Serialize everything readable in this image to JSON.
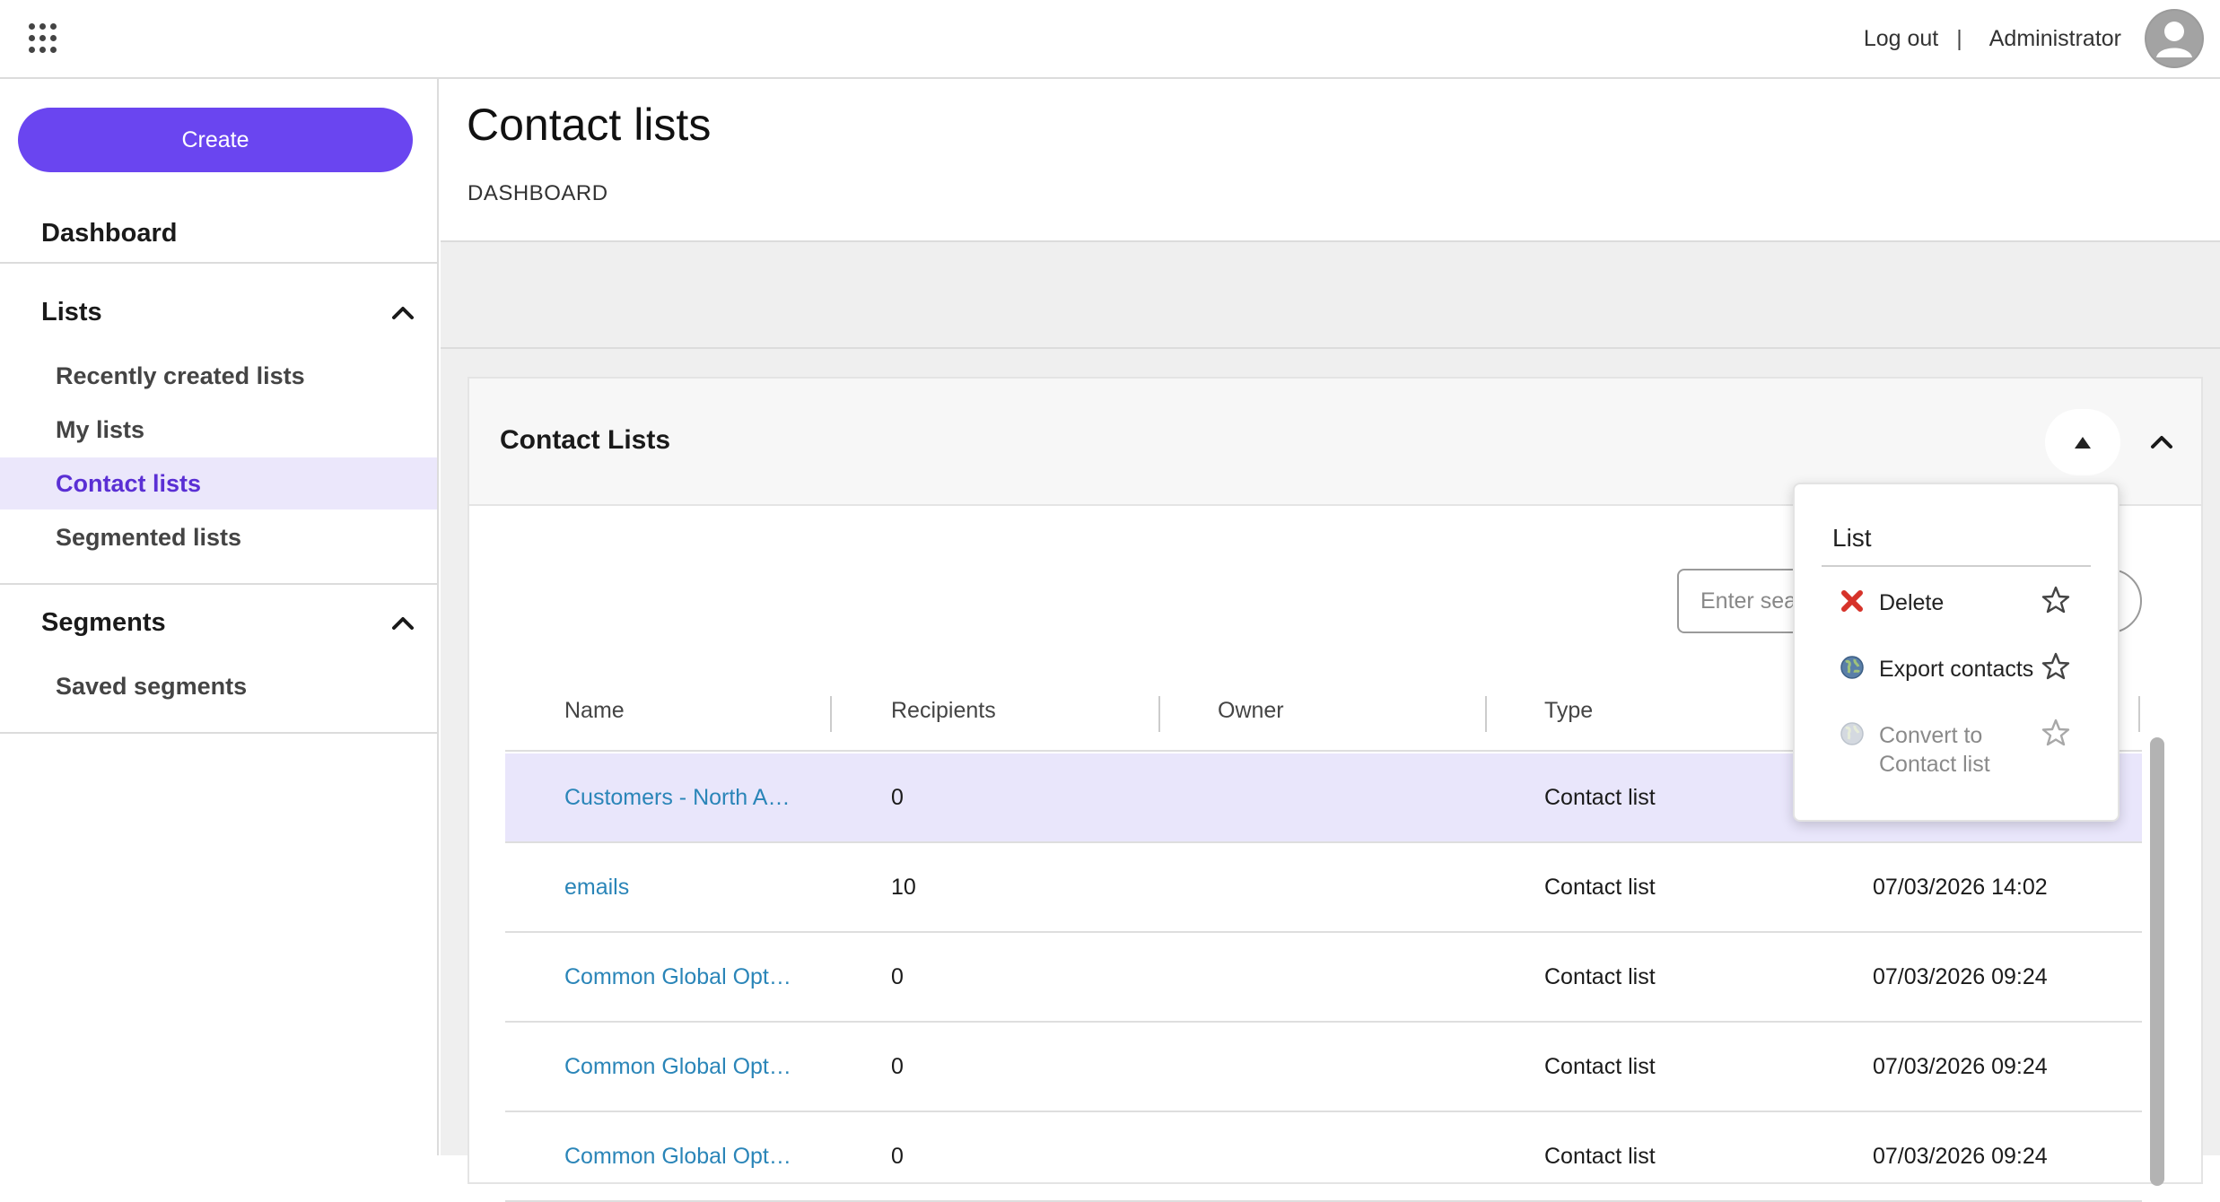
{
  "header": {
    "logout_label": "Log out",
    "separator": "|",
    "user_name": "Administrator"
  },
  "sidebar": {
    "create_label": "Create",
    "dashboard_label": "Dashboard",
    "sections": [
      {
        "label": "Lists",
        "items": [
          {
            "label": "Recently created lists"
          },
          {
            "label": "My lists"
          },
          {
            "label": "Contact lists"
          },
          {
            "label": "Segmented lists"
          }
        ]
      },
      {
        "label": "Segments",
        "items": [
          {
            "label": "Saved segments"
          }
        ]
      }
    ],
    "active_item": "Contact lists",
    "accent_color": "#6a45f0"
  },
  "page": {
    "title": "Contact lists",
    "breadcrumb": "DASHBOARD"
  },
  "panel": {
    "title": "Contact Lists",
    "search_placeholder": "Enter search"
  },
  "table": {
    "columns": [
      "Name",
      "Recipients",
      "Owner",
      "Type"
    ],
    "rows": [
      {
        "name": "Customers - North A…",
        "recipients": "0",
        "owner": "",
        "type": "Contact list",
        "date": ""
      },
      {
        "name": "emails",
        "recipients": "10",
        "owner": "",
        "type": "Contact list",
        "date": "07/03/2026 14:02"
      },
      {
        "name": "Common Global Opt…",
        "recipients": "0",
        "owner": "",
        "type": "Contact list",
        "date": "07/03/2026 09:24"
      },
      {
        "name": "Common Global Opt…",
        "recipients": "0",
        "owner": "",
        "type": "Contact list",
        "date": "07/03/2026 09:24"
      },
      {
        "name": "Common Global Opt…",
        "recipients": "0",
        "owner": "",
        "type": "Contact list",
        "date": "07/03/2026 09:24"
      }
    ]
  },
  "menu": {
    "title": "List",
    "items": [
      {
        "label": "Delete",
        "icon": "delete-x-icon",
        "enabled": true
      },
      {
        "label": "Export contacts",
        "icon": "globe-export-icon",
        "enabled": true
      },
      {
        "label": "Convert to Contact list",
        "icon": "convert-globe-icon",
        "enabled": false
      }
    ]
  }
}
